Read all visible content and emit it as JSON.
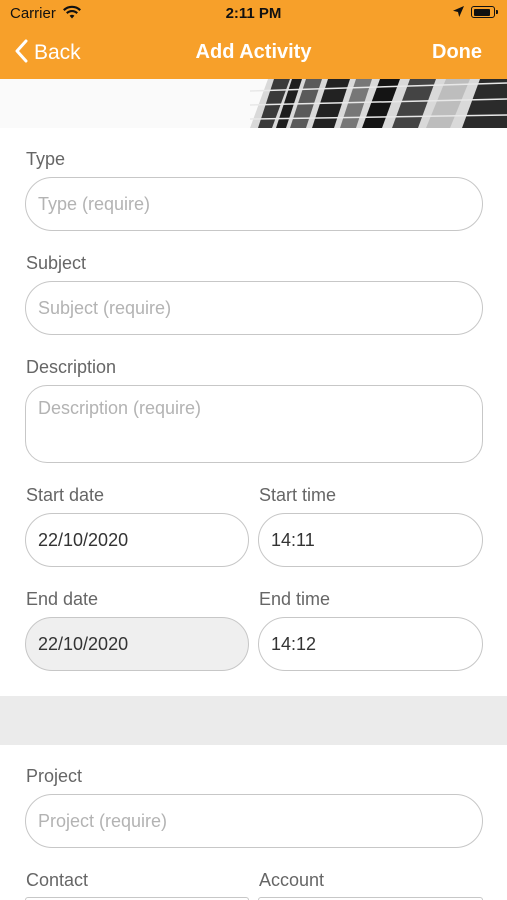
{
  "status_bar": {
    "carrier": "Carrier",
    "time": "2:11 PM",
    "battery_level": 0.9
  },
  "nav": {
    "back_label": "Back",
    "title": "Add Activity",
    "done_label": "Done"
  },
  "form": {
    "type": {
      "label": "Type",
      "placeholder": "Type (require)"
    },
    "subject": {
      "label": "Subject",
      "placeholder": "Subject (require)"
    },
    "description": {
      "label": "Description",
      "placeholder": "Description (require)"
    },
    "start_date": {
      "label": "Start date",
      "value": "22/10/2020"
    },
    "start_time": {
      "label": "Start time",
      "value": "14:11"
    },
    "end_date": {
      "label": "End date",
      "value": "22/10/2020"
    },
    "end_time": {
      "label": "End time",
      "value": "14:12"
    },
    "project": {
      "label": "Project",
      "placeholder": "Project (require)"
    },
    "contact": {
      "label": "Contact"
    },
    "account": {
      "label": "Account"
    }
  },
  "colors": {
    "accent": "#F7A02A",
    "field_border": "#C7C7C7",
    "placeholder": "#B3B3B3",
    "disabled_bg": "#EFEFEF",
    "separator": "#EBEBEB"
  }
}
